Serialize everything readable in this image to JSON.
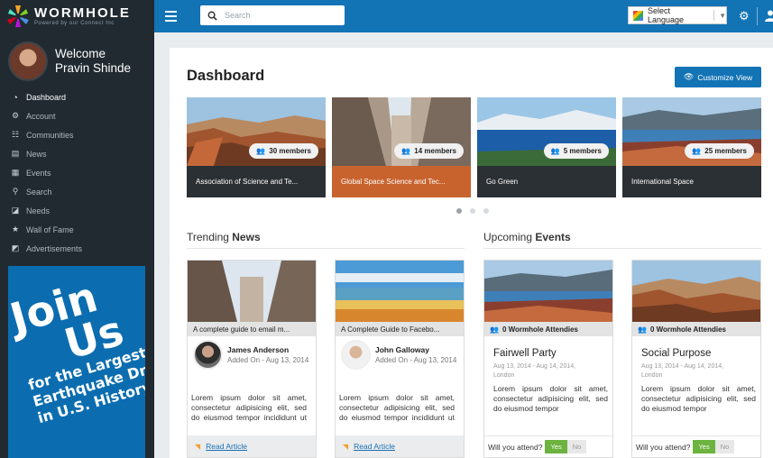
{
  "brand": {
    "name": "WORMHOLE",
    "tagline": "Powered by our Connect Inc"
  },
  "profile": {
    "welcome": "Welcome",
    "name": "Pravin Shinde"
  },
  "nav": [
    {
      "label": "Dashboard",
      "icon": "dashboard-icon",
      "active": true
    },
    {
      "label": "Account",
      "icon": "account-gears-icon"
    },
    {
      "label": "Communities",
      "icon": "communities-icon"
    },
    {
      "label": "News",
      "icon": "news-icon"
    },
    {
      "label": "Events",
      "icon": "calendar-icon"
    },
    {
      "label": "Search",
      "icon": "search-icon"
    },
    {
      "label": "Needs",
      "icon": "needs-icon"
    },
    {
      "label": "Wall of Fame",
      "icon": "star-icon"
    },
    {
      "label": "Advertisements",
      "icon": "advertisement-icon"
    }
  ],
  "ad": {
    "line1": "Join",
    "line2": "Us",
    "line3": "for the Largest",
    "line4": "Earthquake Drill",
    "line5": "in U.S. History."
  },
  "topbar": {
    "search_placeholder": "Search",
    "language": "Select Language"
  },
  "dashboard": {
    "title": "Dashboard",
    "customize": "Customize View"
  },
  "communities": [
    {
      "members": "30 members",
      "name": "Association of Science and Te..."
    },
    {
      "members": "14 members",
      "name": "Global Space Science and Tec..."
    },
    {
      "members": "5 members",
      "name": "Go Green"
    },
    {
      "members": "25 members",
      "name": "International Space"
    }
  ],
  "news_section": {
    "prefix": "Trending",
    "bold": "News"
  },
  "events_section": {
    "prefix": "Upcoming",
    "bold": "Events"
  },
  "news": [
    {
      "caption": "A complete guide to email m...",
      "author": "James Anderson",
      "added": "Added On - Aug 13, 2014",
      "text": "Lorem ipsum dolor sit amet, consectetur adipisicing elit, sed do eiusmod tempor incididunt ut labore",
      "link": "Read Article"
    },
    {
      "caption": "A Complete Guide to Facebo...",
      "author": "John Galloway",
      "added": "Added On - Aug 13, 2014",
      "text": "Lorem ipsum dolor sit amet, consectetur adipisicing elit, sed do eiusmod tempor incididunt ut labore",
      "link": "Read Article"
    }
  ],
  "events": [
    {
      "attendees": "0 Wormhole Attendies",
      "title": "Fairwell Party",
      "dates": "Aug 13, 2014 - Aug 14, 2014,",
      "location": "London",
      "text": "Lorem ipsum dolor sit amet, consectetur adipisicing elit, sed do eiusmod tempor",
      "question": "Will you attend?",
      "yes": "Yes",
      "no": "No"
    },
    {
      "attendees": "0 Wormhole Attendies",
      "title": "Social Purpose",
      "dates": "Aug 13, 2014 - Aug 14, 2014,",
      "location": "London",
      "text": "Lorem ipsum dolor sit amet, consectetur adipisicing elit, sed do eiusmod tempor",
      "question": "Will you attend?",
      "yes": "Yes",
      "no": "No"
    }
  ],
  "colors": {
    "sidebar": "#212a31",
    "topbar": "#1273b5",
    "accent": "#1273b5",
    "highlight": "#c8632e",
    "yes": "#6cb33f"
  }
}
